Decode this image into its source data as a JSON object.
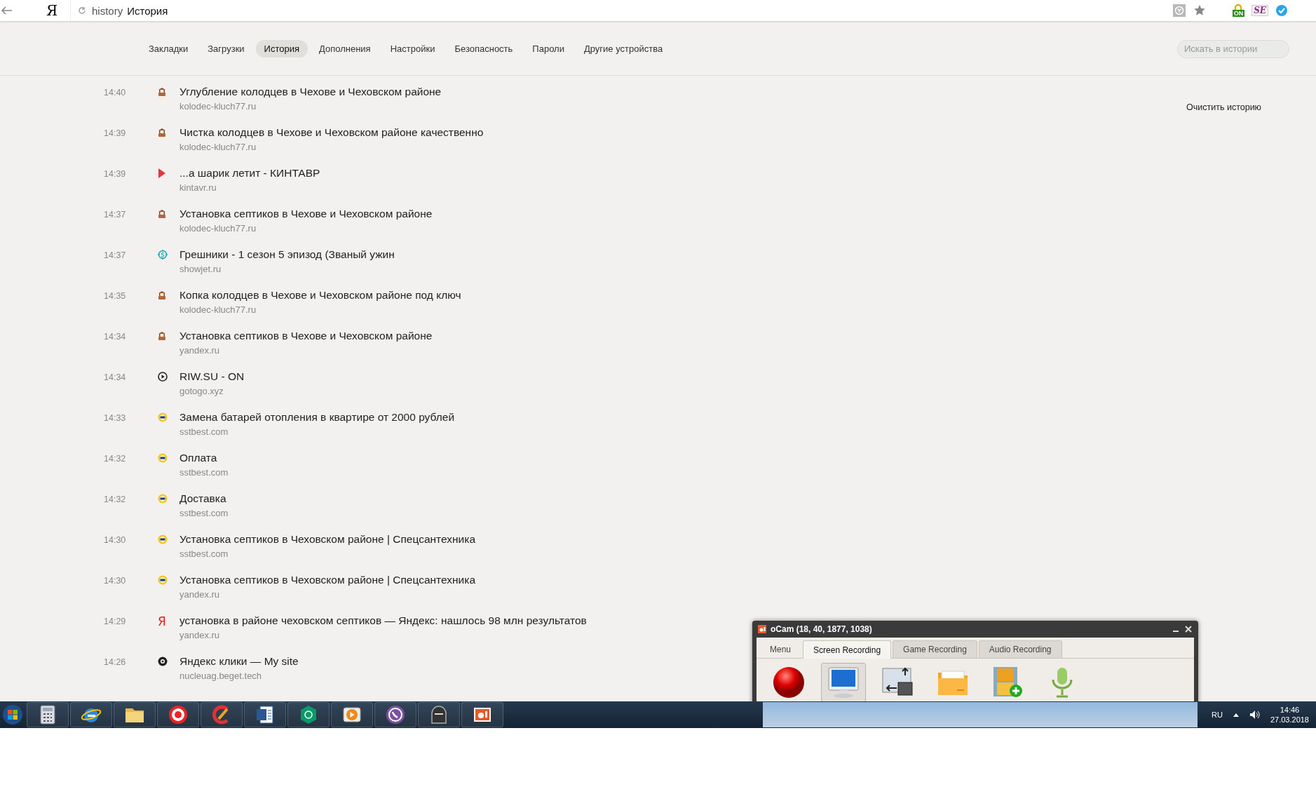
{
  "browser": {
    "logo": "Я",
    "address_scheme": "history",
    "address_title": "История",
    "extensions": [
      {
        "kind": "lock",
        "label": "ON"
      },
      {
        "kind": "se",
        "label": "SE"
      },
      {
        "kind": "check"
      }
    ]
  },
  "nav": {
    "tabs": [
      {
        "label": "Закладки",
        "selected": false
      },
      {
        "label": "Загрузки",
        "selected": false
      },
      {
        "label": "История",
        "selected": true
      },
      {
        "label": "Дополнения",
        "selected": false
      },
      {
        "label": "Настройки",
        "selected": false
      },
      {
        "label": "Безопасность",
        "selected": false
      },
      {
        "label": "Пароли",
        "selected": false
      },
      {
        "label": "Другие устройства",
        "selected": false
      }
    ],
    "search": {
      "placeholder": "Искать в истории"
    }
  },
  "clear_history": "Очистить историю",
  "history": [
    {
      "time": "14:40",
      "kind": "well",
      "title": "Углубление колодцев в Чехове и Чеховском районе",
      "domain": "kolodec-kluch77.ru"
    },
    {
      "time": "14:39",
      "kind": "well",
      "title": "Чистка колодцев в Чехове и Чеховском районе качественно",
      "domain": "kolodec-kluch77.ru"
    },
    {
      "time": "14:39",
      "kind": "triangle",
      "title": "...а шарик летит - КИНТАВР",
      "domain": "kintavr.ru"
    },
    {
      "time": "14:37",
      "kind": "well",
      "title": "Установка септиков в Чехове и Чеховском районе",
      "domain": "kolodec-kluch77.ru"
    },
    {
      "time": "14:37",
      "kind": "coin",
      "title": "Грешники - 1 сезон 5 эпизод (Званый ужин",
      "domain": "showjet.ru"
    },
    {
      "time": "14:35",
      "kind": "well",
      "title": "Копка колодцев в Чехове и Чеховском районе под ключ",
      "domain": "kolodec-kluch77.ru"
    },
    {
      "time": "14:34",
      "kind": "well",
      "title": "Установка септиков в Чехове и Чеховском районе",
      "domain": "yandex.ru"
    },
    {
      "time": "14:34",
      "kind": "play-circle",
      "title": "RIW.SU - ON",
      "domain": "gotogo.xyz"
    },
    {
      "time": "14:33",
      "kind": "sun",
      "title": "Замена батарей отопления в квартире от 2000 рублей",
      "domain": "sstbest.com"
    },
    {
      "time": "14:32",
      "kind": "sun",
      "title": "Оплата",
      "domain": "sstbest.com"
    },
    {
      "time": "14:32",
      "kind": "sun",
      "title": "Доставка",
      "domain": "sstbest.com"
    },
    {
      "time": "14:30",
      "kind": "sun",
      "title": "Установка септиков в Чеховском районе | Спецсантехника",
      "domain": "sstbest.com"
    },
    {
      "time": "14:30",
      "kind": "sun",
      "title": "Установка септиков в Чеховском районе | Спецсантехника",
      "domain": "yandex.ru"
    },
    {
      "time": "14:29",
      "kind": "letter",
      "icon_text": "Я",
      "title": "установка в районе чеховском септиков — Яндекс: нашлось 98 млн результатов",
      "domain": "yandex.ru"
    },
    {
      "time": "14:26",
      "kind": "target",
      "title": "Яндекс клики — My site",
      "domain": "nucleuag.beget.tech"
    }
  ],
  "ocam": {
    "title": "oCam (18, 40, 1877, 1038)",
    "tabs": [
      {
        "label": "Menu",
        "selected": false
      },
      {
        "label": "Screen Recording",
        "selected": true
      },
      {
        "label": "Game Recording",
        "selected": false
      },
      {
        "label": "Audio Recording",
        "selected": false
      }
    ],
    "tools": [
      {
        "kind": "record",
        "selected": false
      },
      {
        "kind": "monitor",
        "selected": true
      },
      {
        "kind": "resize",
        "selected": false
      },
      {
        "kind": "folder",
        "selected": false
      },
      {
        "kind": "film",
        "selected": false
      },
      {
        "kind": "mic",
        "selected": false
      }
    ]
  },
  "taskbar": {
    "apps": [
      {
        "kind": "start"
      },
      {
        "kind": "calculator"
      },
      {
        "kind": "globe"
      },
      {
        "kind": "folder"
      },
      {
        "kind": "ybrowser"
      },
      {
        "kind": "cleaner"
      },
      {
        "kind": "document"
      },
      {
        "kind": "shield"
      },
      {
        "kind": "media"
      },
      {
        "kind": "phone"
      },
      {
        "kind": "ghost"
      },
      {
        "kind": "camera"
      }
    ],
    "language": "RU",
    "time": "14:46",
    "date": "27.03.2018"
  }
}
